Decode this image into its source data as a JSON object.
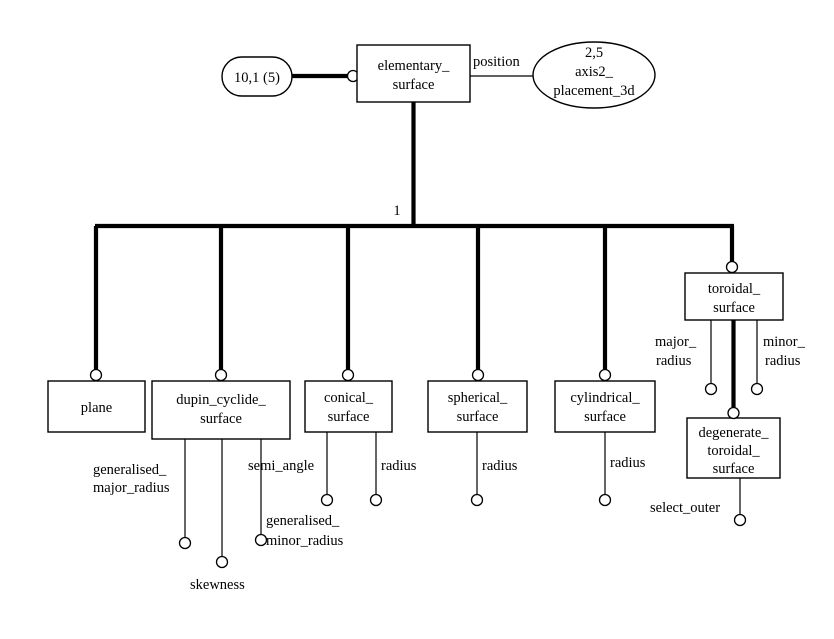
{
  "diagram": {
    "title": "elementary_surface EXPRESS-G entity diagram",
    "notation": "EXPRESS-G",
    "supertype_cardinality": "1",
    "colors": {
      "background": "#ffffff",
      "stroke": "#000000",
      "fill": "#ffffff"
    }
  },
  "page_reference": {
    "label": "10,1 (5)"
  },
  "root_entity": {
    "name_line1": "elementary_",
    "name_line2": "surface"
  },
  "position_attribute": {
    "label": "position"
  },
  "referenced_type": {
    "line1": "2,5",
    "line2": "axis2_",
    "line3": "placement_3d"
  },
  "subtypes": [
    {
      "id": "plane",
      "name_lines": [
        "plane"
      ],
      "attributes": []
    },
    {
      "id": "dupin_cyclide_surface",
      "name_lines": [
        "dupin_cyclide_",
        "surface"
      ],
      "attributes": [
        {
          "label_lines": [
            "generalised_",
            "major_radius"
          ]
        },
        {
          "label_lines": [
            "skewness"
          ]
        },
        {
          "label_lines": [
            "generalised_",
            "minor_radius"
          ]
        }
      ]
    },
    {
      "id": "conical_surface",
      "name_lines": [
        "conical_",
        "surface"
      ],
      "attributes": [
        {
          "label_lines": [
            "semi_angle"
          ]
        },
        {
          "label_lines": [
            "radius"
          ]
        }
      ]
    },
    {
      "id": "spherical_surface",
      "name_lines": [
        "spherical_",
        "surface"
      ],
      "attributes": [
        {
          "label_lines": [
            "radius"
          ]
        }
      ]
    },
    {
      "id": "cylindrical_surface",
      "name_lines": [
        "cylindrical_",
        "surface"
      ],
      "attributes": [
        {
          "label_lines": [
            "radius"
          ]
        }
      ]
    },
    {
      "id": "toroidal_surface",
      "name_lines": [
        "toroidal_",
        "surface"
      ],
      "attributes": [
        {
          "label_lines": [
            "major_",
            "radius"
          ]
        },
        {
          "label_lines": [
            "minor_",
            "radius"
          ]
        }
      ]
    }
  ],
  "toroidal_subtype": {
    "id": "degenerate_toroidal_surface",
    "name_lines": [
      "degenerate_",
      "toroidal_",
      "surface"
    ],
    "attributes": [
      {
        "label_lines": [
          "select_outer"
        ]
      }
    ]
  },
  "labels": {
    "page_ref": "10,1 (5)",
    "elementary_surface_l1": "elementary_",
    "elementary_surface_l2": "surface",
    "position": "position",
    "axis2_l1": "2,5",
    "axis2_l2": "axis2_",
    "axis2_l3": "placement_3d",
    "cardinality_one": "1",
    "plane": "plane",
    "dupin_l1": "dupin_cyclide_",
    "dupin_l2": "surface",
    "conical_l1": "conical_",
    "conical_l2": "surface",
    "spherical_l1": "spherical_",
    "spherical_l2": "surface",
    "cylindrical_l1": "cylindrical_",
    "cylindrical_l2": "surface",
    "toroidal_l1": "toroidal_",
    "toroidal_l2": "surface",
    "degenerate_l1": "degenerate_",
    "degenerate_l2": "toroidal_",
    "degenerate_l3": "surface",
    "gen_major_l1": "generalised_",
    "gen_major_l2": "major_radius",
    "skewness": "skewness",
    "gen_minor_l1": "generalised_",
    "gen_minor_l2": "minor_radius",
    "semi_angle": "semi_angle",
    "radius_conical": "radius",
    "radius_spherical": "radius",
    "radius_cylindrical": "radius",
    "major_radius_l1": "major_",
    "major_radius_l2": "radius",
    "minor_radius_l1": "minor_",
    "minor_radius_l2": "radius",
    "select_outer": "select_outer"
  }
}
